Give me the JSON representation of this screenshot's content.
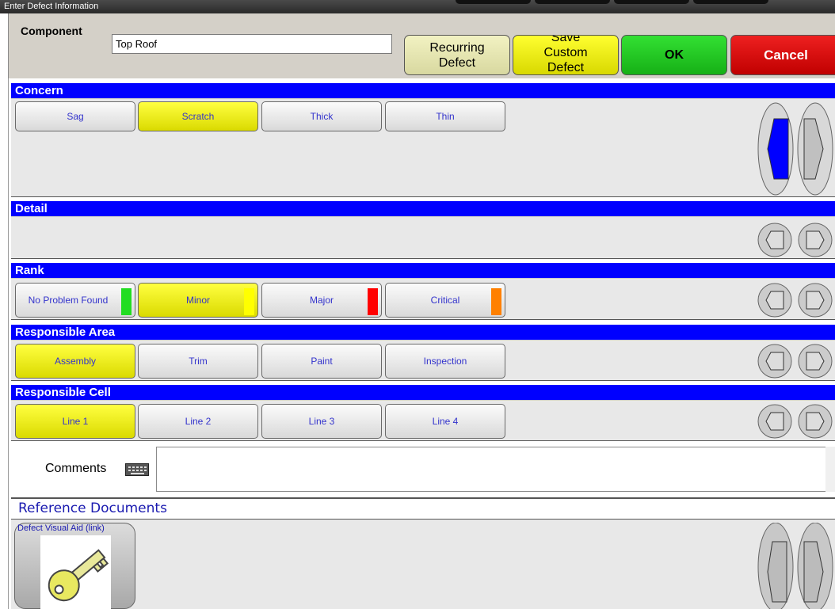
{
  "window": {
    "title": "Enter Defect Information"
  },
  "header": {
    "component_label": "Component",
    "component_value": "Top Roof",
    "recurring_label_1": "Recurring",
    "recurring_label_2": "Defect",
    "save_label_1": "Save",
    "save_label_2": "Custom",
    "save_label_3": "Defect",
    "ok_label": "OK",
    "cancel_label": "Cancel"
  },
  "concern": {
    "title": "Concern",
    "options": [
      "Sag",
      "Scratch",
      "Thick",
      "Thin"
    ],
    "selected": "Scratch"
  },
  "detail": {
    "title": "Detail"
  },
  "rank": {
    "title": "Rank",
    "options": [
      {
        "label": "No Problem Found",
        "color": "#22dd22"
      },
      {
        "label": "Minor",
        "color": "#ffff00"
      },
      {
        "label": "Major",
        "color": "#ff0000"
      },
      {
        "label": "Critical",
        "color": "#ff8000"
      }
    ],
    "selected": "Minor"
  },
  "responsible_area": {
    "title": "Responsible Area",
    "options": [
      "Assembly",
      "Trim",
      "Paint",
      "Inspection"
    ],
    "selected": "Assembly"
  },
  "responsible_cell": {
    "title": "Responsible Cell",
    "options": [
      "Line 1",
      "Line 2",
      "Line 3",
      "Line 4"
    ],
    "selected": "Line 1"
  },
  "comments": {
    "label": "Comments",
    "value": ""
  },
  "reference": {
    "title": "Reference Documents",
    "link_label": "Defect Visual Aid (link)"
  },
  "colors": {
    "section_bar": "#0000ff",
    "selected": "#ffff00",
    "ok": "#22cc22",
    "cancel": "#dd0000"
  },
  "icons": [
    "keyboard-icon",
    "key-icon",
    "arrow-left-icon",
    "arrow-right-icon"
  ]
}
